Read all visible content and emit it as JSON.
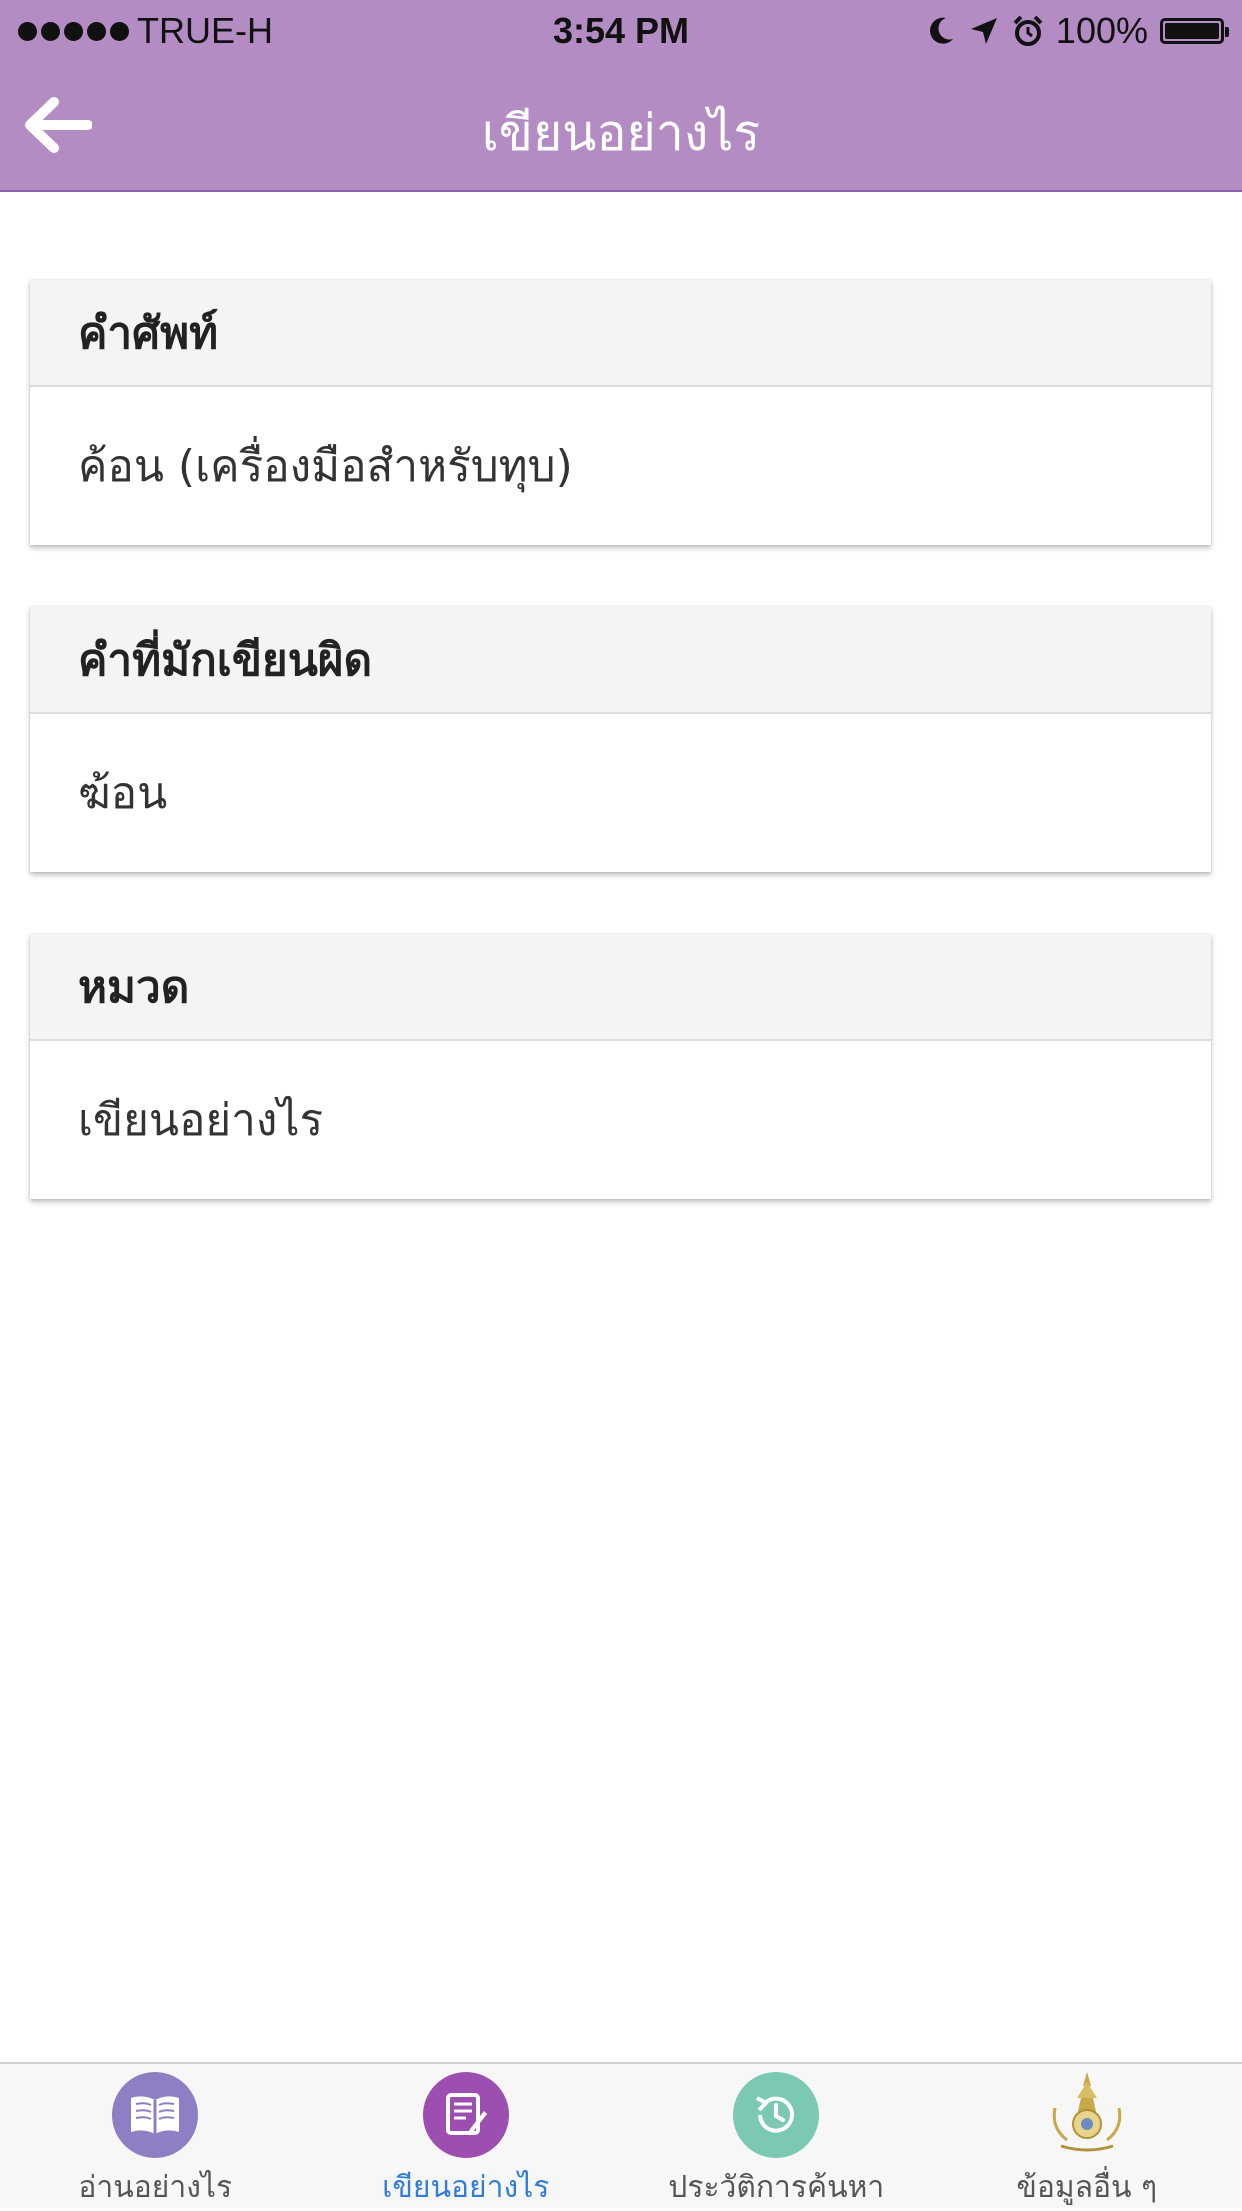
{
  "status_bar": {
    "carrier": "TRUE-H",
    "time": "3:54 PM",
    "battery": "100%"
  },
  "app_bar": {
    "title": "เขียนอย่างไร"
  },
  "cards": [
    {
      "header": "คำศัพท์",
      "value": "ค้อน (เครื่องมือสำหรับทุบ)"
    },
    {
      "header": "คำที่มักเขียนผิด",
      "value": "ฆ้อน"
    },
    {
      "header": "หมวด",
      "value": "เขียนอย่างไร"
    }
  ],
  "tabs": [
    {
      "label": "อ่านอย่างไร",
      "icon": "book-icon",
      "color": "#8e7fc4"
    },
    {
      "label": "เขียนอย่างไร",
      "icon": "edit-note-icon",
      "color": "#9c4fb0",
      "active": true
    },
    {
      "label": "ประวัติการค้นหา",
      "icon": "history-icon",
      "color": "#7cc9b3"
    },
    {
      "label": "ข้อมูลอื่น ๆ",
      "icon": "royal-institute-logo"
    }
  ],
  "colors": {
    "primary": "#b38cc4",
    "active_tab": "#2f7be0"
  }
}
